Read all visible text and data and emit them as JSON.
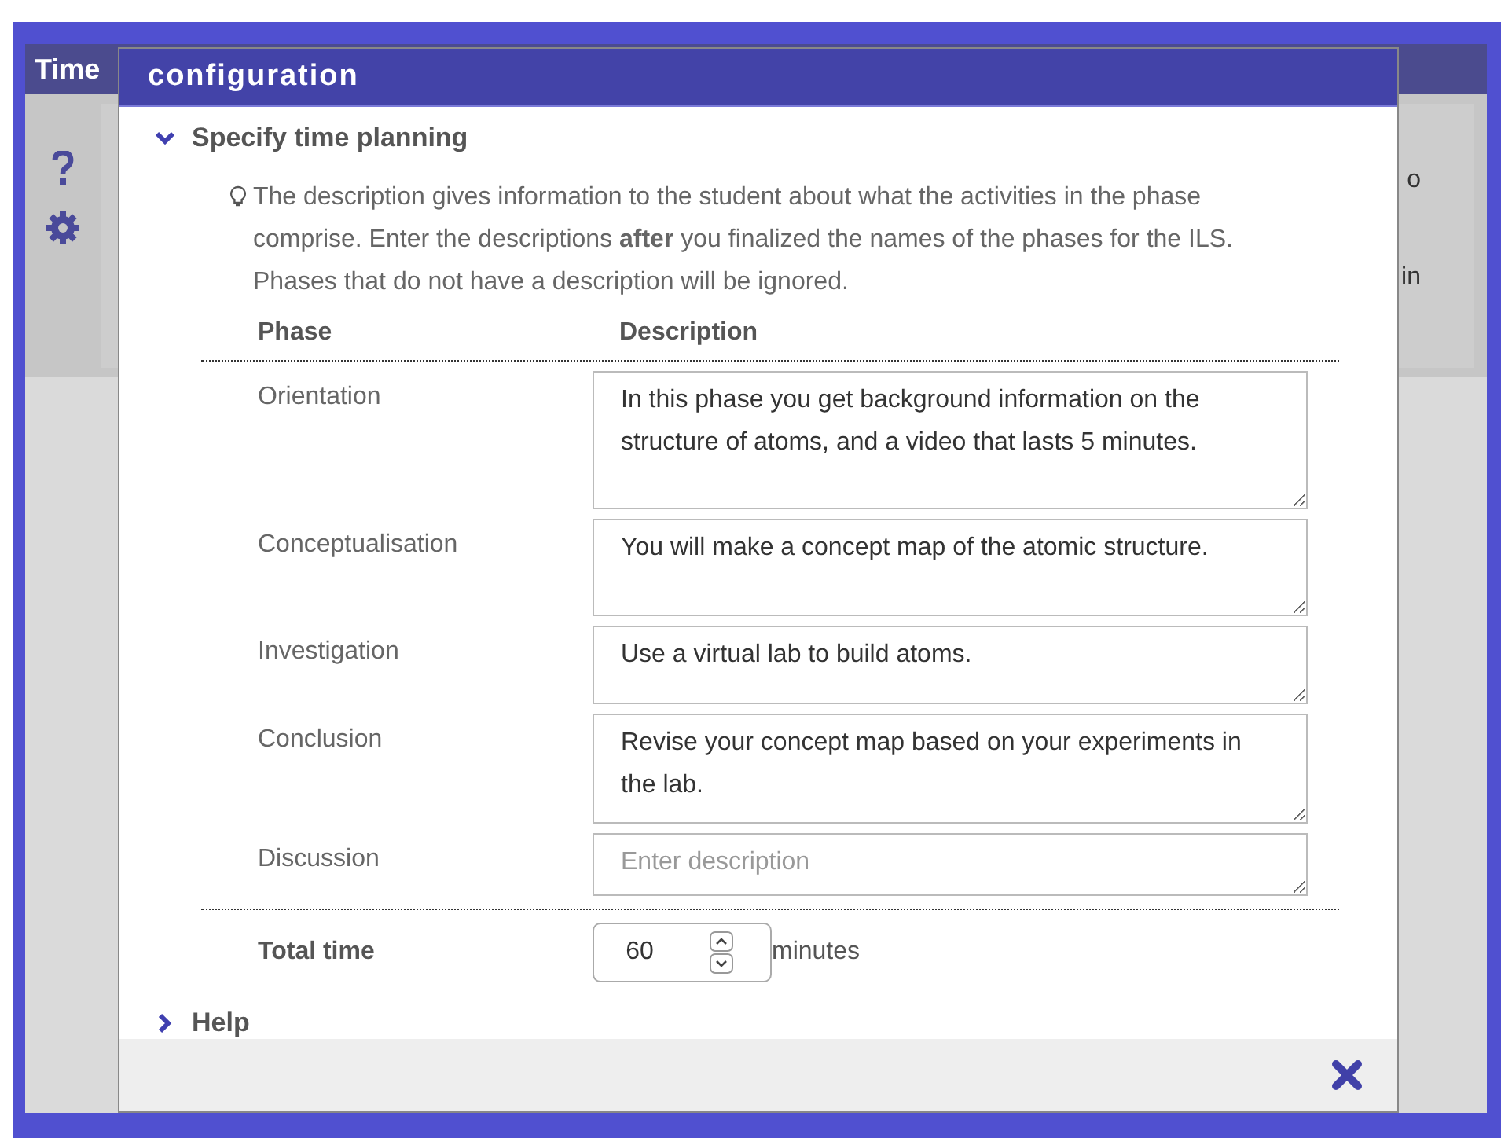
{
  "background_window": {
    "title": "Time",
    "right_texts": [
      "o",
      "in"
    ]
  },
  "dialog": {
    "title": "configuration",
    "time_planning": {
      "title": "Specify time planning",
      "expanded": true,
      "hint": "The description gives information to the student about what the activities in the phase comprise. Enter the descriptions **after** you finalized the names of the phases for the ILS. Phases that do not have a description will be ignored.",
      "columns": [
        "Phase",
        "Description"
      ],
      "rows": [
        {
          "phase": "Orientation",
          "description": "In this phase you get background information on the structure of atoms, and a video that lasts 5 minutes."
        },
        {
          "phase": "Conceptualisation",
          "description": "You will make a concept map of the atomic structure."
        },
        {
          "phase": "Investigation",
          "description": "Use a virtual lab to build atoms."
        },
        {
          "phase": "Conclusion",
          "description": "Revise your concept map based on your experiments in the lab."
        },
        {
          "phase": "Discussion",
          "placeholder": "Enter description"
        }
      ],
      "total": {
        "label": "Total time",
        "value": "60",
        "unit": "minutes"
      }
    },
    "help": {
      "title": "Help",
      "expanded": false
    }
  }
}
